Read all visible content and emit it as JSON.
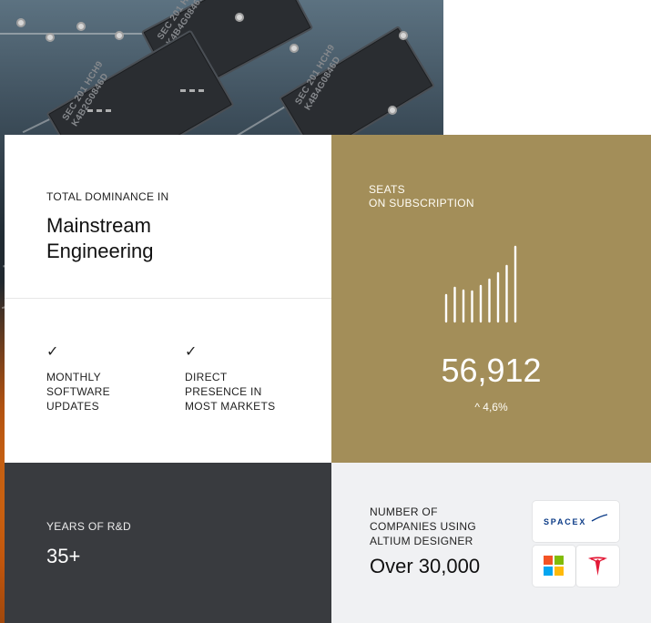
{
  "hero": {
    "chip_labels": [
      "SEC 201 HCH9\nK4B4G0846B",
      "SEC 201 HCH9\nK4B2G0846D",
      "SEC 201 HCH9\nK4B4G0846D"
    ]
  },
  "dominance": {
    "label": "TOTAL DOMINANCE IN",
    "title": "Mainstream\nEngineering"
  },
  "features": [
    {
      "icon": "check-icon",
      "text": "MONTHLY\nSOFTWARE\nUPDATES"
    },
    {
      "icon": "check-icon",
      "text": "DIRECT\nPRESENCE IN\nMOST MARKETS"
    }
  ],
  "seats": {
    "label": "SEATS\nON SUBSCRIPTION",
    "value": "56,912",
    "change": "^ 4,6%",
    "bar_levels": [
      0.35,
      0.45,
      0.42,
      0.4,
      0.48,
      0.56,
      0.65,
      0.74,
      1.0
    ]
  },
  "years": {
    "label": "YEARS OF R&D",
    "value": "35+"
  },
  "companies": {
    "label": "NUMBER OF\nCOMPANIES USING\nALTIUM DESIGNER",
    "value": "Over 30,000",
    "logos": {
      "spacex": "SPACEX",
      "microsoft": "microsoft-logo",
      "tesla": "tesla-logo"
    }
  },
  "colors": {
    "gold": "#a38e59",
    "dark": "#393b3f",
    "light": "#f0f1f3",
    "tesla": "#e31937",
    "spacex": "#0b3b87"
  }
}
